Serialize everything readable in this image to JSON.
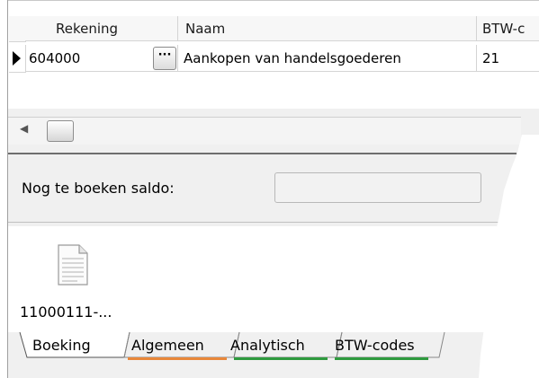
{
  "grid": {
    "columns": [
      "Rekening",
      "Naam",
      "BTW-c"
    ],
    "rows": [
      {
        "rekening": "604000",
        "naam": "Aankopen van handelsgoederen",
        "btw": "21"
      }
    ],
    "ellipsis": "···"
  },
  "saldo": {
    "label": "Nog te boeken saldo:",
    "value": ""
  },
  "attachments": [
    {
      "name": "11000111-..."
    }
  ],
  "tabs": [
    {
      "label": "Boeking",
      "color": ""
    },
    {
      "label": "Algemeen",
      "color": "#e8873a"
    },
    {
      "label": "Analytisch",
      "color": "#2e9a3e"
    },
    {
      "label": "BTW-codes",
      "color": "#2e9a3e"
    }
  ]
}
